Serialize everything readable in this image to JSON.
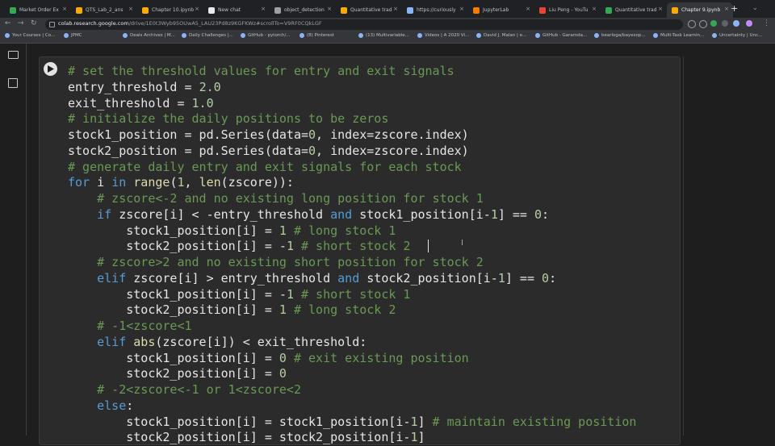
{
  "tabs": [
    {
      "title": "Market Order Ex",
      "color": "#34a853"
    },
    {
      "title": "QTS_Lab_2_ans",
      "color": "#f9ab00"
    },
    {
      "title": "Chapter 10.ipynb",
      "color": "#f9ab00"
    },
    {
      "title": "New chat",
      "color": "#e8eaed"
    },
    {
      "title": "object_detection",
      "color": "#9aa0a6"
    },
    {
      "title": "Quantitative trad",
      "color": "#f9ab00"
    },
    {
      "title": "https://curiously",
      "color": "#8ab4f8"
    },
    {
      "title": "JupyterLab",
      "color": "#f57c00"
    },
    {
      "title": "Liu Peng - YouTu",
      "color": "#ea4335"
    },
    {
      "title": "Quantitative trad",
      "color": "#34a853"
    },
    {
      "title": "Chapter 9.ipynb",
      "color": "#f9ab00",
      "active": true
    }
  ],
  "address": {
    "host": "colab.research.google.com",
    "path": "/drive/1E0t3Wyb95OUwA5_LAU23Pd8z9KGFKWz#scrollTo=V9RF0CQkLGF"
  },
  "bookmarks": [
    "Your Courses | Co...",
    "JPMC",
    "Deals Archives | M...",
    "Daily Challenges |...",
    "GitHub - pytorch/...",
    "(8) Pinterest",
    "(13) Multivariable...",
    "Videos | A 2020 Vi...",
    "David J. Malan | e...",
    "GitHub - Garamda...",
    "bearloga/bayesop...",
    "Multi-Task Learnin...",
    "Uncertainty | Unc..."
  ],
  "code_lines": [
    [
      [
        "c",
        "# set the threshold values for entry and exit signals"
      ]
    ],
    [
      [
        "t",
        "entry_threshold = "
      ],
      [
        "n",
        "2.0"
      ]
    ],
    [
      [
        "t",
        "exit_threshold = "
      ],
      [
        "n",
        "1.0"
      ]
    ],
    [
      [
        "c",
        "# initialize the daily positions to be zeros"
      ]
    ],
    [
      [
        "t",
        "stock1_position = pd.Series(data="
      ],
      [
        "n",
        "0"
      ],
      [
        "t",
        ", index=zscore.index)"
      ]
    ],
    [
      [
        "t",
        "stock2_position = pd.Series(data="
      ],
      [
        "n",
        "0"
      ],
      [
        "t",
        ", index=zscore.index)"
      ]
    ],
    [
      [
        "c",
        "# generate daily entry and exit signals for each stock"
      ]
    ],
    [
      [
        "k",
        "for"
      ],
      [
        "t",
        " i "
      ],
      [
        "k",
        "in"
      ],
      [
        "t",
        " "
      ],
      [
        "f",
        "range"
      ],
      [
        "t",
        "("
      ],
      [
        "n",
        "1"
      ],
      [
        "t",
        ", "
      ],
      [
        "f",
        "len"
      ],
      [
        "t",
        "(zscore)):"
      ]
    ],
    [
      [
        "t",
        "    "
      ],
      [
        "c",
        "# zscore<-2 and no existing long position for stock 1"
      ]
    ],
    [
      [
        "t",
        "    "
      ],
      [
        "k",
        "if"
      ],
      [
        "t",
        " zscore[i] < -entry_threshold "
      ],
      [
        "k",
        "and"
      ],
      [
        "t",
        " stock1_position[i-"
      ],
      [
        "n",
        "1"
      ],
      [
        "t",
        "] == "
      ],
      [
        "n",
        "0"
      ],
      [
        "t",
        ":"
      ]
    ],
    [
      [
        "t",
        "        stock1_position[i] = "
      ],
      [
        "n",
        "1"
      ],
      [
        "t",
        " "
      ],
      [
        "c",
        "# long stock 1"
      ]
    ],
    [
      [
        "t",
        "        stock2_position[i] = -"
      ],
      [
        "n",
        "1"
      ],
      [
        "t",
        " "
      ],
      [
        "c",
        "# short stock 2"
      ]
    ],
    [
      [
        "t",
        "    "
      ],
      [
        "c",
        "# zscore>2 and no existing short position for stock 2"
      ]
    ],
    [
      [
        "t",
        "    "
      ],
      [
        "k",
        "elif"
      ],
      [
        "t",
        " zscore[i] > entry_threshold "
      ],
      [
        "k",
        "and"
      ],
      [
        "t",
        " stock2_position[i-"
      ],
      [
        "n",
        "1"
      ],
      [
        "t",
        "] == "
      ],
      [
        "n",
        "0"
      ],
      [
        "t",
        ":"
      ]
    ],
    [
      [
        "t",
        "        stock1_position[i] = -"
      ],
      [
        "n",
        "1"
      ],
      [
        "t",
        " "
      ],
      [
        "c",
        "# short stock 1"
      ]
    ],
    [
      [
        "t",
        "        stock2_position[i] = "
      ],
      [
        "n",
        "1"
      ],
      [
        "t",
        " "
      ],
      [
        "c",
        "# long stock 2"
      ]
    ],
    [
      [
        "t",
        "    "
      ],
      [
        "c",
        "# -1<zscore<1"
      ]
    ],
    [
      [
        "t",
        "    "
      ],
      [
        "k",
        "elif"
      ],
      [
        "t",
        " "
      ],
      [
        "f",
        "abs"
      ],
      [
        "t",
        "(zscore[i]) < exit_threshold:"
      ]
    ],
    [
      [
        "t",
        "        stock1_position[i] = "
      ],
      [
        "n",
        "0"
      ],
      [
        "t",
        " "
      ],
      [
        "c",
        "# exit existing position"
      ]
    ],
    [
      [
        "t",
        "        stock2_position[i] = "
      ],
      [
        "n",
        "0"
      ]
    ],
    [
      [
        "t",
        "    "
      ],
      [
        "c",
        "# -2<zscore<-1 or 1<zscore<2"
      ]
    ],
    [
      [
        "t",
        "    "
      ],
      [
        "k",
        "else"
      ],
      [
        "t",
        ":"
      ]
    ],
    [
      [
        "t",
        "        stock1_position[i] = stock1_position[i-"
      ],
      [
        "n",
        "1"
      ],
      [
        "t",
        "] "
      ],
      [
        "c",
        "# maintain existing position"
      ]
    ],
    [
      [
        "t",
        "        stock2_position[i] = stock2_position[i-"
      ],
      [
        "n",
        "1"
      ],
      [
        "t",
        "]"
      ]
    ]
  ]
}
